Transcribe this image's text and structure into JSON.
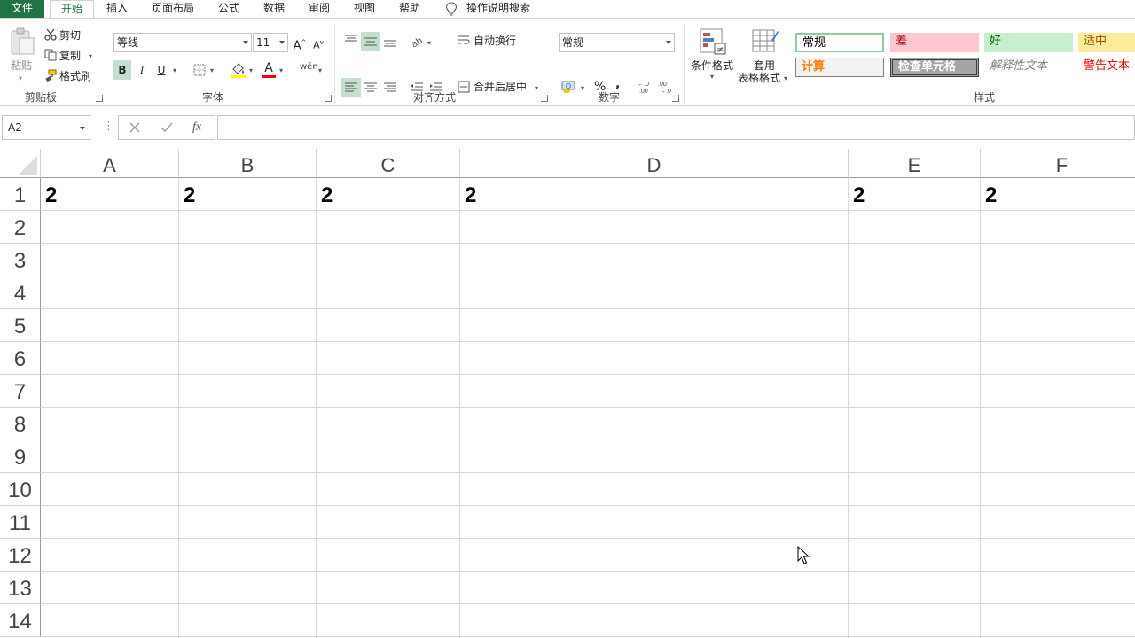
{
  "menu": {
    "file": "文件",
    "home": "开始",
    "insert": "插入",
    "page_layout": "页面布局",
    "formulas": "公式",
    "data": "数据",
    "review": "审阅",
    "view": "视图",
    "help": "帮助",
    "tell_me": "操作说明搜索"
  },
  "ribbon": {
    "clipboard": {
      "label": "剪贴板",
      "paste": "粘贴",
      "cut": "剪切",
      "copy": "复制",
      "format_painter": "格式刷"
    },
    "font": {
      "label": "字体",
      "font_name": "等线",
      "font_size": "11",
      "bold": "B",
      "italic": "I",
      "underline": "U"
    },
    "alignment": {
      "label": "对齐方式",
      "wrap_text": "自动换行",
      "merge_center": "合并后居中"
    },
    "number": {
      "label": "数字",
      "format": "常规",
      "percent": "%",
      "comma": ","
    },
    "styles_group": {
      "label": "样式",
      "conditional_formatting": "条件格式",
      "format_as_table_line1": "套用",
      "format_as_table_line2": "表格格式",
      "normal": "常规",
      "bad": "差",
      "good": "好",
      "neutral": "适中",
      "calculation": "计算",
      "check_cell": "检查单元格",
      "explanatory": "解释性文本",
      "warning": "警告文本"
    }
  },
  "formula_bar": {
    "name_box": "A2",
    "fx": "fx",
    "content": ""
  },
  "sheet": {
    "columns": [
      "A",
      "B",
      "C",
      "D",
      "E",
      "F"
    ],
    "rows": [
      "1",
      "2",
      "3",
      "4",
      "5",
      "6",
      "7",
      "8",
      "9",
      "10",
      "11",
      "12",
      "13",
      "14"
    ],
    "row1": [
      "2",
      "2",
      "2",
      "2",
      "2",
      "2"
    ]
  },
  "colors": {
    "accent": "#217346",
    "bad_bg": "#ffc7ce",
    "bad_fg": "#9c0006",
    "good_bg": "#c6efce",
    "good_fg": "#006100",
    "neutral_bg": "#ffeb9c",
    "neutral_fg": "#9c5700",
    "calc_fg": "#fa7d00",
    "check_bg": "#a5a5a5",
    "warning_fg": "#ff0000"
  }
}
